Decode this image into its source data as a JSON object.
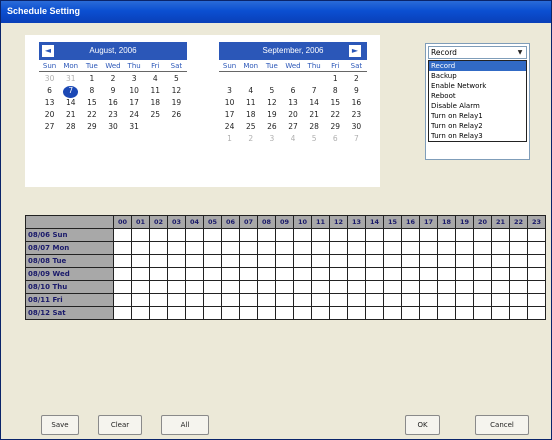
{
  "window": {
    "title": "Schedule Setting"
  },
  "calendars": [
    {
      "month": "August, 2006",
      "nav": "◄",
      "weekdays": [
        "Sun",
        "Mon",
        "Tue",
        "Wed",
        "Thu",
        "Fri",
        "Sat"
      ],
      "days": [
        [
          "30",
          "other"
        ],
        [
          "31",
          "other"
        ],
        [
          "1",
          ""
        ],
        [
          "2",
          ""
        ],
        [
          "3",
          ""
        ],
        [
          "4",
          ""
        ],
        [
          "5",
          ""
        ],
        [
          "6",
          ""
        ],
        [
          "7",
          "sel"
        ],
        [
          "8",
          ""
        ],
        [
          "9",
          ""
        ],
        [
          "10",
          ""
        ],
        [
          "11",
          ""
        ],
        [
          "12",
          ""
        ],
        [
          "13",
          ""
        ],
        [
          "14",
          ""
        ],
        [
          "15",
          ""
        ],
        [
          "16",
          ""
        ],
        [
          "17",
          ""
        ],
        [
          "18",
          ""
        ],
        [
          "19",
          ""
        ],
        [
          "20",
          ""
        ],
        [
          "21",
          ""
        ],
        [
          "22",
          ""
        ],
        [
          "23",
          ""
        ],
        [
          "24",
          ""
        ],
        [
          "25",
          ""
        ],
        [
          "26",
          ""
        ],
        [
          "27",
          ""
        ],
        [
          "28",
          ""
        ],
        [
          "29",
          ""
        ],
        [
          "30",
          ""
        ],
        [
          "31",
          ""
        ]
      ]
    },
    {
      "month": "September, 2006",
      "nav": "►",
      "weekdays": [
        "Sun",
        "Mon",
        "Tue",
        "Wed",
        "Thu",
        "Fri",
        "Sat"
      ],
      "days": [
        [
          "",
          ""
        ],
        [
          "",
          ""
        ],
        [
          "",
          ""
        ],
        [
          "",
          ""
        ],
        [
          "",
          ""
        ],
        [
          "1",
          ""
        ],
        [
          "2",
          ""
        ],
        [
          "3",
          ""
        ],
        [
          "4",
          ""
        ],
        [
          "5",
          ""
        ],
        [
          "6",
          ""
        ],
        [
          "7",
          ""
        ],
        [
          "8",
          ""
        ],
        [
          "9",
          ""
        ],
        [
          "10",
          ""
        ],
        [
          "11",
          ""
        ],
        [
          "12",
          ""
        ],
        [
          "13",
          ""
        ],
        [
          "14",
          ""
        ],
        [
          "15",
          ""
        ],
        [
          "16",
          ""
        ],
        [
          "17",
          ""
        ],
        [
          "18",
          ""
        ],
        [
          "19",
          ""
        ],
        [
          "20",
          ""
        ],
        [
          "21",
          ""
        ],
        [
          "22",
          ""
        ],
        [
          "23",
          ""
        ],
        [
          "24",
          ""
        ],
        [
          "25",
          ""
        ],
        [
          "26",
          ""
        ],
        [
          "27",
          ""
        ],
        [
          "28",
          ""
        ],
        [
          "29",
          ""
        ],
        [
          "30",
          ""
        ],
        [
          "1",
          "other"
        ],
        [
          "2",
          "other"
        ],
        [
          "3",
          "other"
        ],
        [
          "4",
          "other"
        ],
        [
          "5",
          "other"
        ],
        [
          "6",
          "other"
        ],
        [
          "7",
          "other"
        ]
      ]
    }
  ],
  "event_selector": {
    "value": "Record",
    "options": [
      "Record",
      "Backup",
      "Enable Network",
      "Reboot",
      "Disable Alarm",
      "Turn on Relay1",
      "Turn on Relay2",
      "Turn on Relay3"
    ],
    "highlighted": 0
  },
  "schedule": {
    "hours": [
      "00",
      "01",
      "02",
      "03",
      "04",
      "05",
      "06",
      "07",
      "08",
      "09",
      "10",
      "11",
      "12",
      "13",
      "14",
      "15",
      "16",
      "17",
      "18",
      "19",
      "20",
      "21",
      "22",
      "23"
    ],
    "rows": [
      "08/06 Sun",
      "08/07 Mon",
      "08/08 Tue",
      "08/09 Wed",
      "08/10 Thu",
      "08/11 Fri",
      "08/12 Sat"
    ]
  },
  "buttons": {
    "save": "Save",
    "clear": "Clear",
    "all": "All",
    "ok": "OK",
    "cancel": "Cancel"
  }
}
